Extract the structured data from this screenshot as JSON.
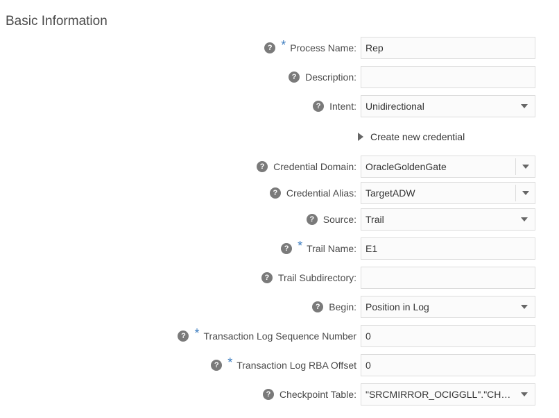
{
  "section": {
    "title": "Basic Information"
  },
  "disclosure": {
    "label": "Create new credential"
  },
  "fields": {
    "process_name": {
      "label": "Process Name:",
      "value": "Rep",
      "required": true
    },
    "description": {
      "label": "Description:",
      "value": ""
    },
    "intent": {
      "label": "Intent:",
      "value": "Unidirectional"
    },
    "credential_domain": {
      "label": "Credential Domain:",
      "value": "OracleGoldenGate"
    },
    "credential_alias": {
      "label": "Credential Alias:",
      "value": "TargetADW"
    },
    "source": {
      "label": "Source:",
      "value": "Trail"
    },
    "trail_name": {
      "label": "Trail Name:",
      "value": "E1",
      "required": true
    },
    "trail_subdirectory": {
      "label": "Trail Subdirectory:",
      "value": ""
    },
    "begin": {
      "label": "Begin:",
      "value": "Position in Log"
    },
    "tx_log_seq": {
      "label": "Transaction Log Sequence Number",
      "value": "0",
      "required": true
    },
    "tx_log_rba": {
      "label": "Transaction Log RBA Offset",
      "value": "0",
      "required": true
    },
    "checkpoint_table": {
      "label": "Checkpoint Table:",
      "value": "\"SRCMIRROR_OCIGGLL\".\"CHECK..."
    }
  },
  "icons": {
    "help": "?",
    "required_marker": "*"
  },
  "colors": {
    "required": "#3a7bbf",
    "help_icon_bg": "#7a7a7a"
  }
}
